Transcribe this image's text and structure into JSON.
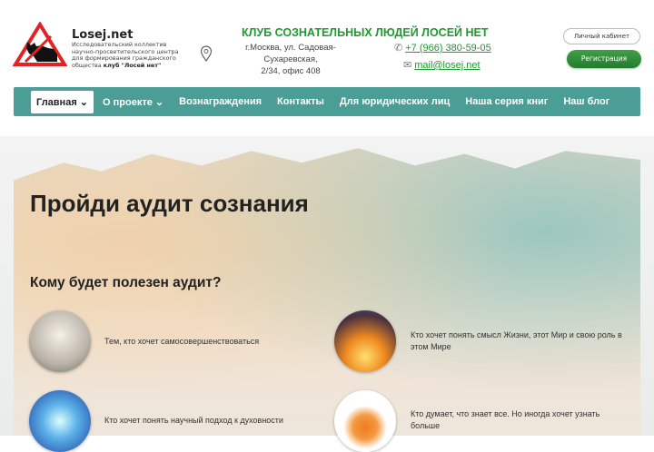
{
  "header": {
    "brand": "Losej.net",
    "tagline": "Исследовательский коллектив научно-просветительского центра для формирования гражданского общества",
    "tagline_bold": "клуб \"Лосей нет\"",
    "club_title": "КЛУБ СОЗНАТЕЛЬНЫХ ЛЮДЕЙ ЛОСЕЙ НЕТ",
    "address_line1": "г.Москва, ул. Садовая-Сухаревская,",
    "address_line2": "2/34, офис 408",
    "phone": "+7 (966) 380-59-05",
    "email": "mail@losej.net",
    "cabinet_label": "Личный кабинет",
    "register_label": "Регистрация"
  },
  "nav": {
    "items": [
      {
        "label": "Главная ⌄"
      },
      {
        "label": "О проекте ⌄"
      },
      {
        "label": "Вознаграждения"
      },
      {
        "label": "Контакты"
      },
      {
        "label": "Для юридических лиц"
      },
      {
        "label": "Наша серия книг"
      },
      {
        "label": "Наш блог"
      }
    ]
  },
  "main": {
    "title": "Пройди аудит сознания",
    "subtitle": "Кому будет полезен аудит?",
    "items": [
      {
        "text": "Тем, кто хочет самосовершенствоваться"
      },
      {
        "text": "Кто хочет понять смысл Жизни, этот Мир и свою роль в этом Мире"
      },
      {
        "text": "Кто хочет понять научный подход к духовности"
      },
      {
        "text": "Кто думает, что знает все. Но иногда хочет узнать больше"
      }
    ]
  },
  "colors": {
    "accent": "#1e9a2d",
    "nav": "#4a9e96"
  }
}
